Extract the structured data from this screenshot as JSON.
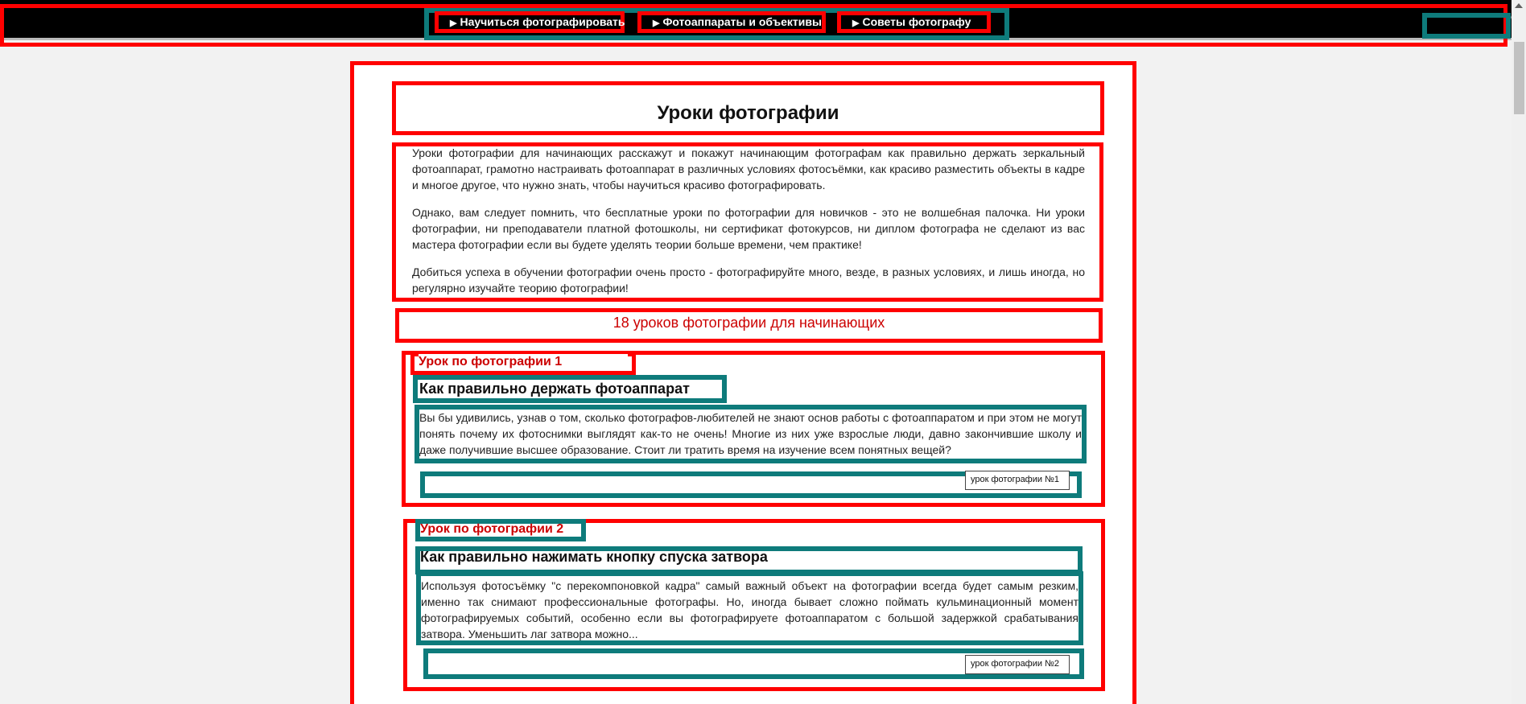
{
  "nav": {
    "items": [
      {
        "label": "Научиться фотографировать"
      },
      {
        "label": "Фотоаппараты и объективы"
      },
      {
        "label": "Советы фотографу"
      }
    ],
    "triangle": "▶",
    "search_icon": "search-icon"
  },
  "page": {
    "title": "Уроки фотографии",
    "intro": [
      "Уроки фотографии для начинающих расскажут и покажут начинающим фотографам как правильно держать зеркальный фотоаппарат, грамотно настраивать фотоаппарат в различных условиях фотосъёмки, как красиво разместить объекты в кадре и многое другое, что нужно знать, чтобы научиться красиво фотографировать.",
      "Однако, вам следует помнить, что бесплатные уроки по фотографии для новичков - это не волшебная палочка. Ни уроки фотографии, ни преподаватели платной фотошколы, ни сертификат фотокурсов, ни диплом фотографа не сделают из вас мастера фотографии если вы будете уделять теории больше времени, чем практике!",
      "Добиться успеха в обучении фотографии очень просто - фотографируйте много, везде, в разных условиях, и лишь иногда, но регулярно изучайте теорию фотографии!"
    ],
    "section_heading": "18 уроков фотографии для начинающих"
  },
  "lessons": [
    {
      "label": "Урок по фотографии 1",
      "title": "Как правильно держать фотоаппарат",
      "text": "Вы бы удивились, узнав о том, сколько фотографов-любителей не знают основ работы с фотоаппаратом и при этом не могут понять почему их фотоснимки выглядят как-то не очень! Многие из них уже взрослые люди, давно закончившие школу и даже получившие высшее образование. Стоит ли тратить время на изучение всем понятных вещей?",
      "button": "урок фотографии №1"
    },
    {
      "label": "Урок по фотографии 2",
      "title": "Как правильно нажимать кнопку спуска затвора",
      "text": "Используя фотосъёмку \"с перекомпоновкой кадра\" самый важный объект на фотографии всегда будет самым резким, именно так снимают профессиональные фотографы. Но, иногда бывает сложно поймать кульминационный момент фотографируемых событий, особенно если вы фотографируете фотоаппаратом с большой задержкой срабатывания затвора. Уменьшить лаг затвора можно...",
      "button": "урок фотографии №2"
    }
  ],
  "colors": {
    "annotation_red": "#ff0000",
    "annotation_teal": "#0e7b7b",
    "accent_red": "#cc0000",
    "nav_bg": "#000000"
  }
}
